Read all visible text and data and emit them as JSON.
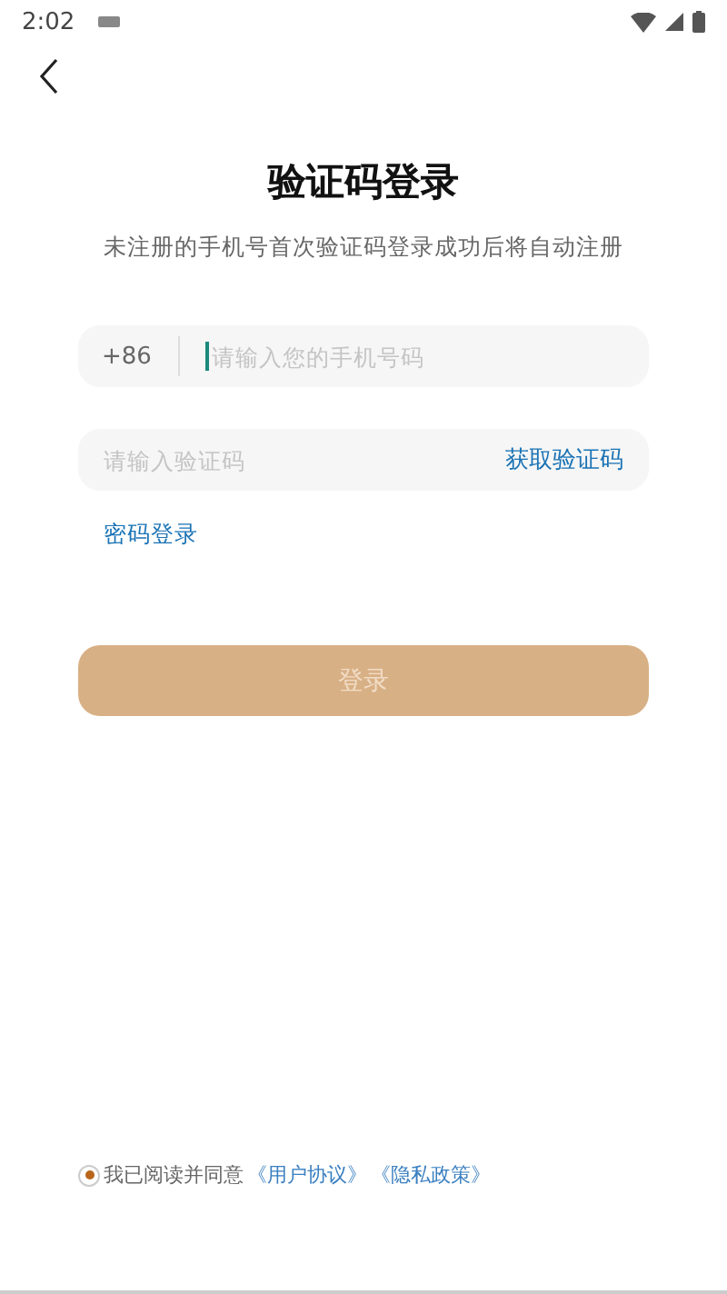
{
  "status_bar": {
    "time": "2:02"
  },
  "title": "验证码登录",
  "subtitle": "未注册的手机号首次验证码登录成功后将自动注册",
  "phone_field": {
    "prefix": "+86",
    "placeholder": "请输入您的手机号码",
    "focused": true
  },
  "code_field": {
    "placeholder": "请输入验证码",
    "action": "获取验证码"
  },
  "password_login_link": "密码登录",
  "login_button": {
    "label": "登录",
    "disabled": true
  },
  "agreement": {
    "checked": true,
    "text": "我已阅读并同意",
    "links": [
      "《用户协议》",
      "《隐私政策》"
    ]
  }
}
